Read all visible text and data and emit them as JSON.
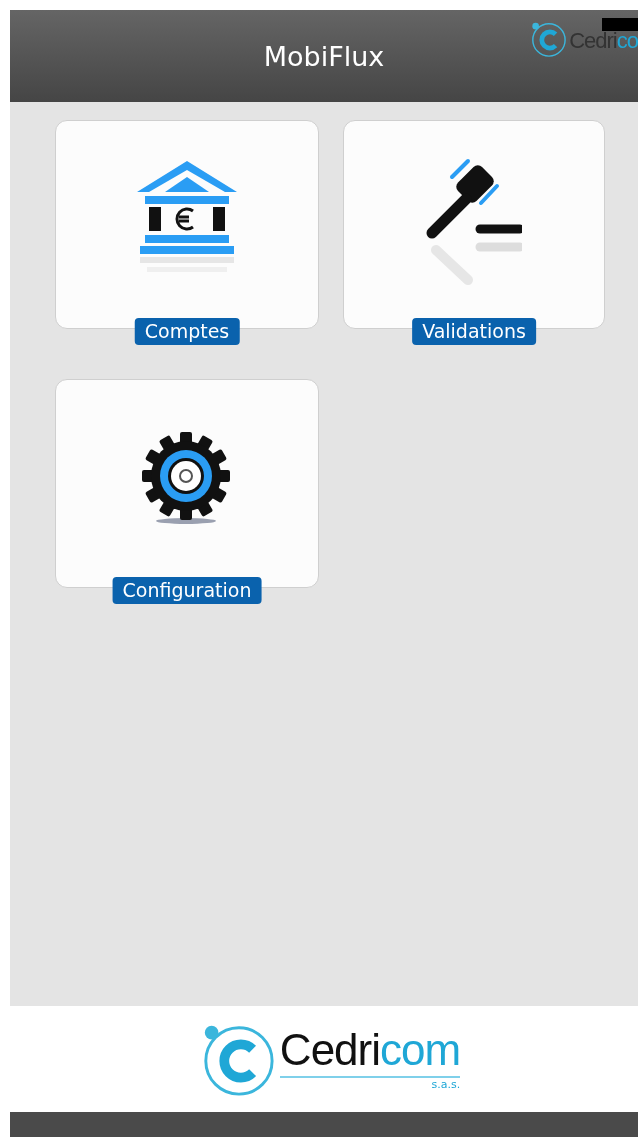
{
  "header": {
    "title": "MobiFlux",
    "logo": {
      "dark": "Cedri",
      "accent": "co"
    }
  },
  "tiles": [
    {
      "kind": "bank",
      "label": "Comptes"
    },
    {
      "kind": "gavel",
      "label": "Validations"
    },
    {
      "kind": "gear",
      "label": "Configuration"
    }
  ],
  "footer": {
    "logo": {
      "dark": "Cedri",
      "accent": "com",
      "suffix": "s.a.s."
    }
  }
}
